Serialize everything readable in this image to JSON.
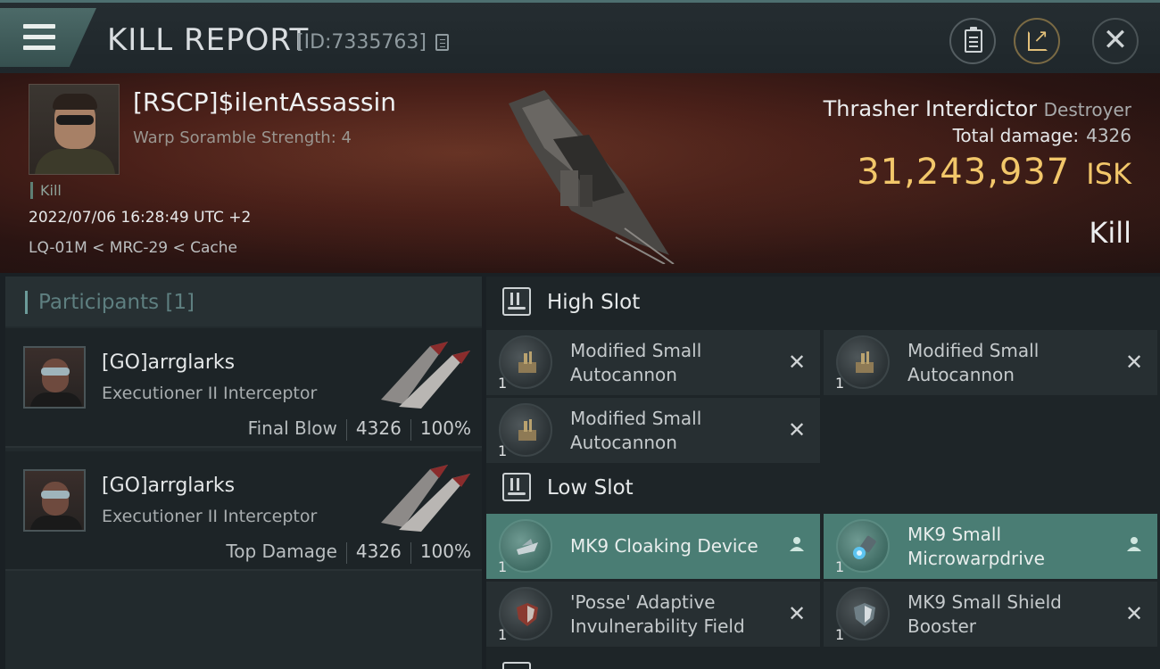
{
  "header": {
    "title": "KILL REPORT",
    "report_id": "[ID:7335763]"
  },
  "victim": {
    "name": "[RSCP]$ilentAssassin",
    "subtitle": "Warp Soramble Strength: 4",
    "tag": "Kill",
    "datetime": "2022/07/06 16:28:49 UTC +2",
    "location": "LQ-01M < MRC-29 < Cache",
    "ship_name": "Thrasher Interdictor",
    "ship_class": "Destroyer",
    "total_damage_label": "Total damage:",
    "total_damage": "4326",
    "isk_value": "31,243,937",
    "isk_unit": "ISK",
    "outcome": "Kill"
  },
  "participants": {
    "title": "Participants [1]",
    "rows": [
      {
        "name": "[GO]arrglarks",
        "ship": "Executioner II Interceptor",
        "label": "Final Blow",
        "damage": "4326",
        "percent": "100%"
      },
      {
        "name": "[GO]arrglarks",
        "ship": "Executioner II Interceptor",
        "label": "Top Damage",
        "damage": "4326",
        "percent": "100%"
      }
    ]
  },
  "fitting": {
    "high_slot": {
      "title": "High Slot",
      "modules": [
        {
          "name": "Modified Small Autocannon",
          "qty": "1",
          "status_icon": "close-icon"
        },
        {
          "name": "Modified Small Autocannon",
          "qty": "1",
          "status_icon": "close-icon"
        },
        {
          "name": "Modified Small Autocannon",
          "qty": "1",
          "status_icon": "close-icon"
        }
      ]
    },
    "low_slot": {
      "title": "Low Slot",
      "modules": [
        {
          "name": "MK9 Cloaking Device",
          "qty": "1",
          "status_icon": "person-icon",
          "highlight": true
        },
        {
          "name": "MK9 Small Microwarpdrive",
          "qty": "1",
          "status_icon": "person-icon",
          "highlight": true
        },
        {
          "name": "'Posse' Adaptive Invulnerability Field",
          "qty": "1",
          "status_icon": "close-icon"
        },
        {
          "name": "MK9 Small Shield Booster",
          "qty": "1",
          "status_icon": "close-icon"
        }
      ]
    }
  },
  "icons": {
    "close": "✕",
    "person": "👤"
  },
  "colors": {
    "isk": "#f2c76a",
    "fitted_highlight": "#4a7d74",
    "accent_teal": "#6c9b9a"
  }
}
